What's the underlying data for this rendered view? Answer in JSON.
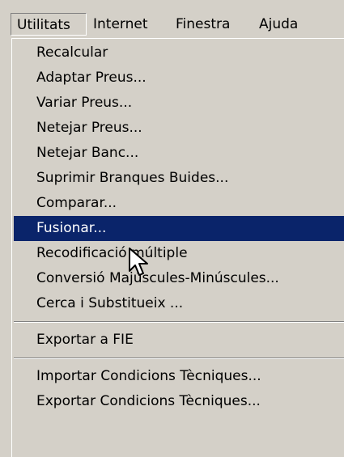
{
  "menubar": {
    "items": [
      {
        "label": "Utilitats"
      },
      {
        "label": "Internet"
      },
      {
        "label": "Finestra"
      },
      {
        "label": "Ajuda"
      }
    ]
  },
  "dropdown": {
    "group1": [
      {
        "label": "Recalcular"
      },
      {
        "label": "Adaptar Preus..."
      },
      {
        "label": "Variar Preus..."
      },
      {
        "label": "Netejar Preus..."
      },
      {
        "label": "Netejar Banc..."
      },
      {
        "label": "Suprimir Branques Buides..."
      },
      {
        "label": "Comparar..."
      },
      {
        "label": "Fusionar..."
      },
      {
        "label": "Recodificació múltiple"
      },
      {
        "label": "Conversió Majúscules-Minúscules..."
      },
      {
        "label": "Cerca i Substitueix ..."
      }
    ],
    "group2": [
      {
        "label": "Exportar a FIE"
      }
    ],
    "group3": [
      {
        "label": "Importar Condicions Tècniques..."
      },
      {
        "label": "Exportar Condicions Tècniques..."
      }
    ],
    "highlighted_label": "Fusionar..."
  },
  "colors": {
    "background": "#d4d0c8",
    "highlight": "#0a246a",
    "highlight_text": "#ffffff"
  },
  "cursor": {
    "icon": "arrow-cursor-icon"
  }
}
